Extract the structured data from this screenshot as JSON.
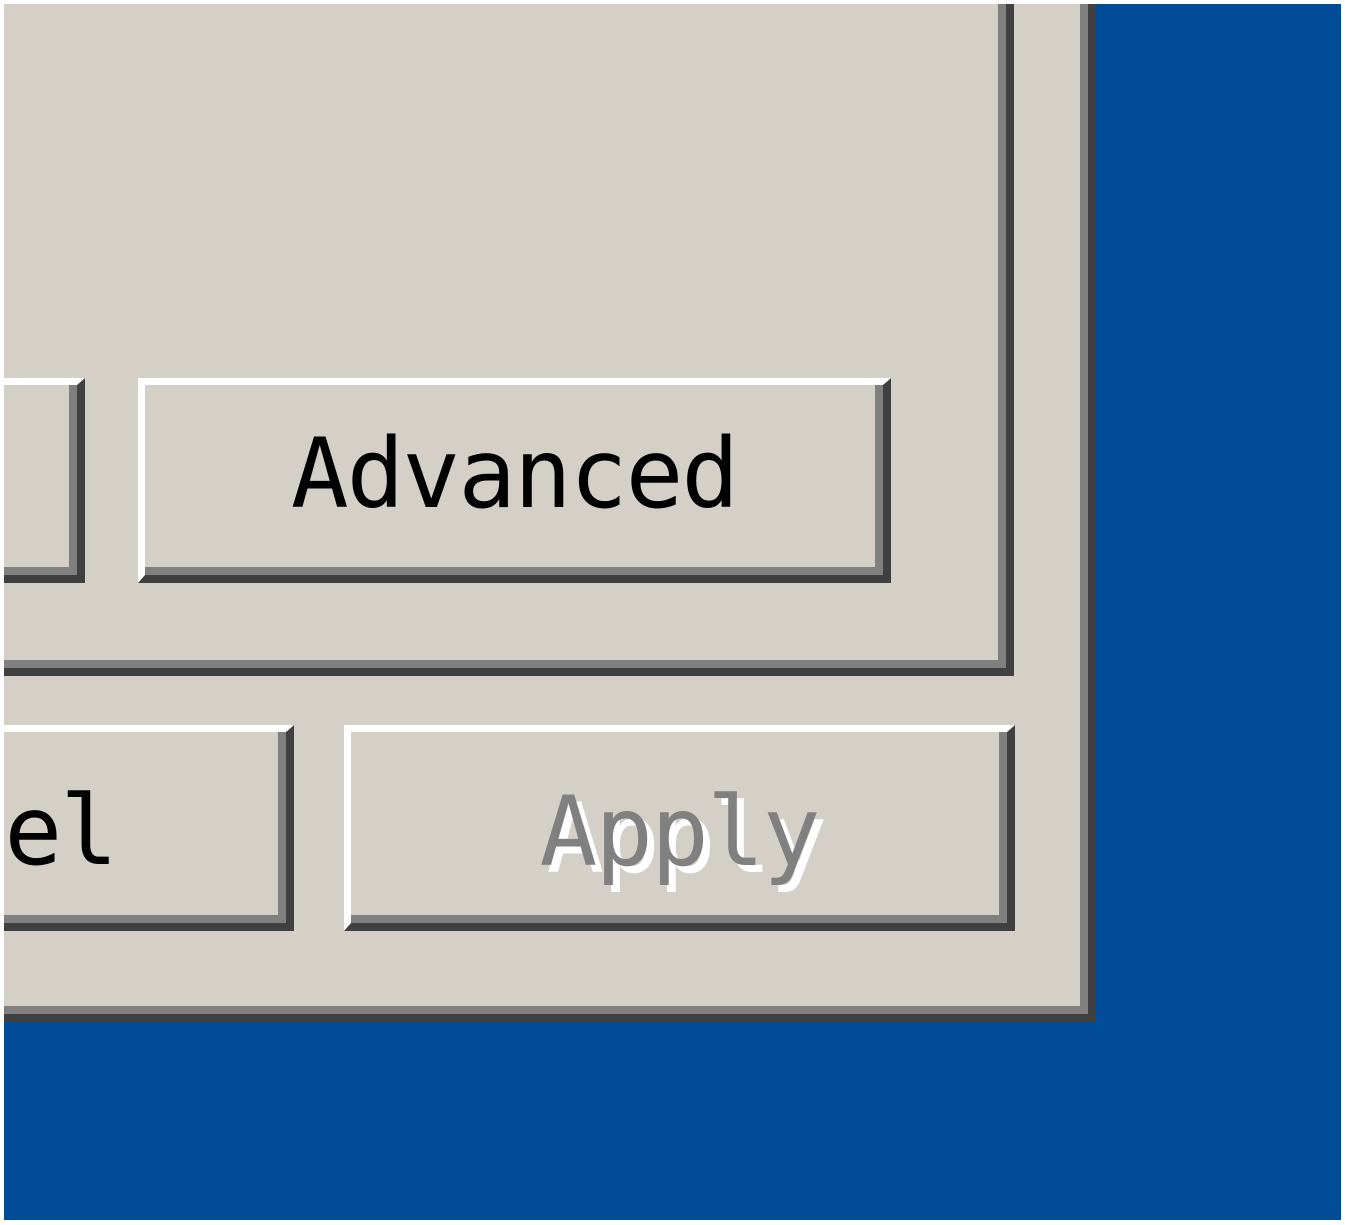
{
  "dialog": {
    "advanced_button_label": "Advanced",
    "cancel_button_label": "cel",
    "apply_button_label": "Apply",
    "apply_button_state": "disabled"
  },
  "colors": {
    "desktop_background": "#004C97",
    "dialog_face": "#D4D0C8",
    "highlight": "#FFFFFF",
    "shadow": "#808080",
    "dark_shadow": "#404040",
    "disabled_text": "#808080"
  }
}
